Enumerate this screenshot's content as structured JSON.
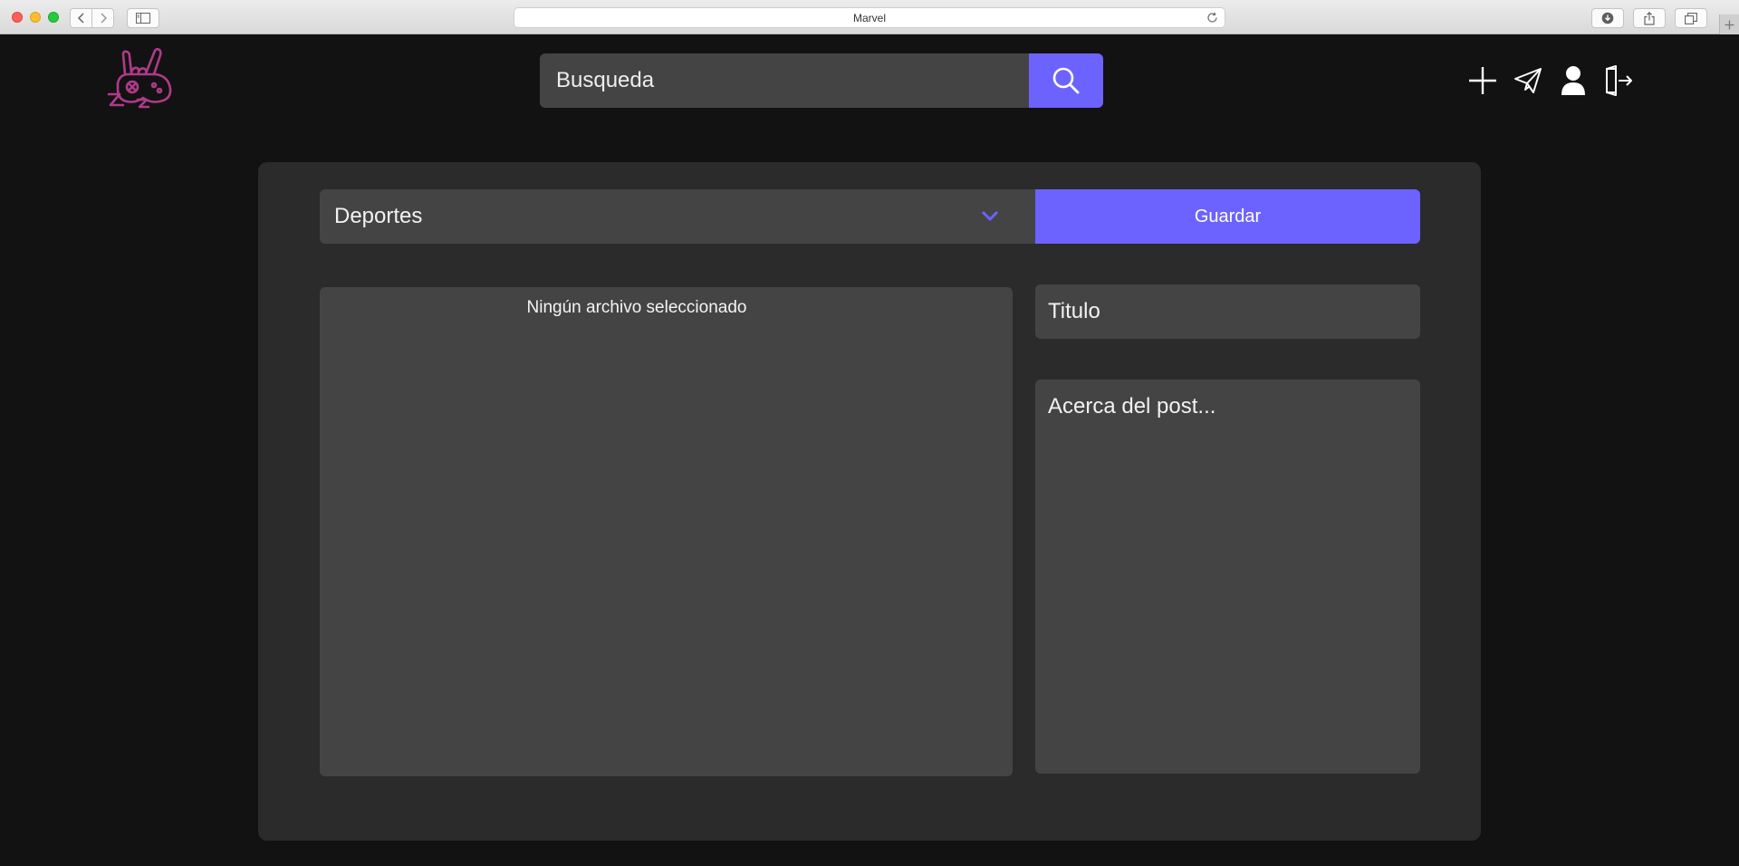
{
  "browser": {
    "page_title": "Marvel"
  },
  "header": {
    "search": {
      "placeholder": "Busqueda"
    },
    "icons": [
      "plus-icon",
      "send-icon",
      "user-icon",
      "logout-icon"
    ]
  },
  "form": {
    "category_selected": "Deportes",
    "save_label": "Guardar",
    "file_status": "Ningún archivo seleccionado",
    "title_placeholder": "Titulo",
    "about_placeholder": "Acerca del post..."
  },
  "colors": {
    "background": "#121212",
    "card": "#2b2b2b",
    "field": "#444444",
    "accent": "#6c63ff",
    "logo": "#b03a8a"
  }
}
